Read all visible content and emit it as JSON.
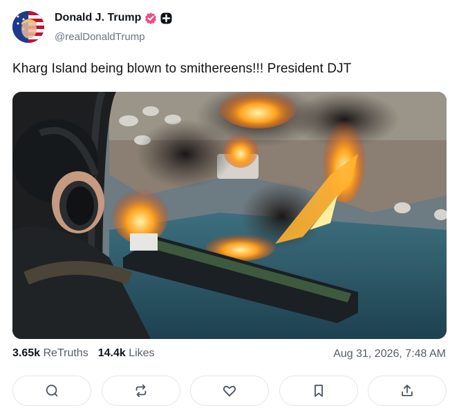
{
  "author": {
    "display_name": "Donald J. Trump",
    "handle": "@realDonaldTrump",
    "verified_color": "#e8508a"
  },
  "post": {
    "text": "Kharg Island being blown to smithereens!!! President DJT"
  },
  "stats": {
    "retruths_count": "3.65k",
    "retruths_label": "ReTruths",
    "likes_count": "14.4k",
    "likes_label": "Likes"
  },
  "timestamp": "Aug 31, 2026, 7:48 AM",
  "actions": [
    {
      "name": "reply",
      "icon": "comment-icon"
    },
    {
      "name": "retruth",
      "icon": "repost-icon"
    },
    {
      "name": "like",
      "icon": "heart-icon"
    },
    {
      "name": "bookmark",
      "icon": "bookmark-icon"
    },
    {
      "name": "share",
      "icon": "share-icon"
    }
  ]
}
